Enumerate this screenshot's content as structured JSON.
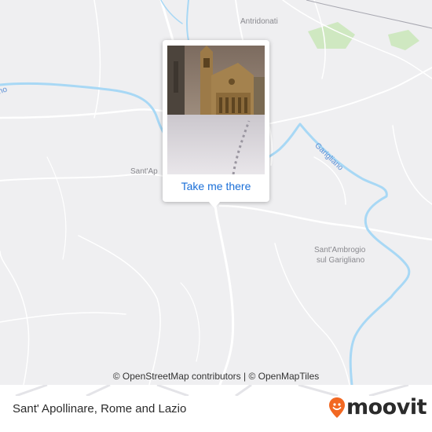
{
  "map": {
    "places": [
      {
        "name": "Antridonati"
      },
      {
        "name": "Sant'Ap"
      },
      {
        "name": "Sant'Ambrogio"
      },
      {
        "name": "sul Garigliano"
      }
    ],
    "river_label": "Garigliano",
    "edge_label": "no",
    "popup": {
      "photo_alt": "Church of Sant' Apollinare in snow",
      "link_text": "Take me there"
    },
    "attribution": {
      "osm": "© OpenStreetMap contributors",
      "separator": "|",
      "tiles": "© OpenMapTiles"
    },
    "colors": {
      "background": "#efeff1",
      "road": "#ffffff",
      "river": "#a8d8f5",
      "park": "#cfe8c1",
      "link": "#1a6fd8",
      "brand": "#f26822"
    }
  },
  "footer": {
    "title": "Sant' Apollinare, Rome and Lazio",
    "brand": "moovit",
    "brand_icon": "moovit-pin-icon"
  }
}
